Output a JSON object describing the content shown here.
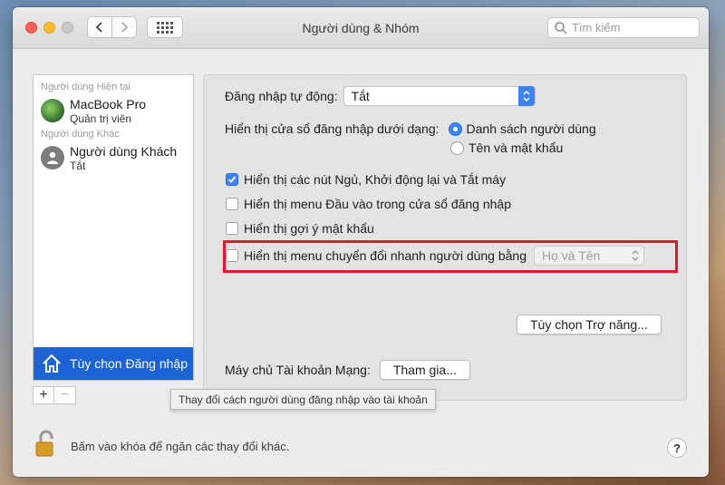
{
  "window": {
    "title": "Người dùng & Nhóm"
  },
  "toolbar": {
    "back_icon": "chevron-left-icon",
    "forward_icon": "chevron-right-icon",
    "grid_icon": "grid-icon",
    "search_placeholder": "Tìm kiếm"
  },
  "sidebar": {
    "current_header": "Người dùng Hiện tại",
    "other_header": "Người dùng Khác",
    "users": [
      {
        "name": "MacBook Pro",
        "role": "Quản trị viên"
      },
      {
        "name": "Người dùng Khách",
        "role": "Tắt"
      }
    ],
    "login_options_label": "Tùy chọn Đăng nhập",
    "add_label": "+",
    "remove_label": "−"
  },
  "tooltip": "Thay đổi cách người dùng đăng nhập vào tài khoản",
  "panel": {
    "auto_login_label": "Đăng nhập tự động:",
    "auto_login_value": "Tắt",
    "display_login_label": "Hiển thị cửa sổ đăng nhập dưới dạng:",
    "radio_list": "Danh sách người dùng",
    "radio_name_password": "Tên và mật khẩu",
    "check_sleep_restart": "Hiển thị các nút Ngủ, Khởi động lại và Tắt máy",
    "check_input_menu": "Hiển thị menu Đầu vào trong cửa sổ đăng nhập",
    "check_password_hint": "Hiển thị gợi ý mật khẩu",
    "check_fast_switch": "Hiển thị menu chuyển đổi nhanh người dùng bằng",
    "fast_switch_value": "Họ và Tên",
    "accessibility_button": "Tùy chọn Trợ năng...",
    "network_server_label": "Máy chủ Tài khoản Mạng:",
    "join_button": "Tham gia..."
  },
  "footer": {
    "lock_text": "Bấm vào khóa để ngăn các thay đổi khác.",
    "help_label": "?"
  },
  "colors": {
    "accent": "#3d83f5",
    "selection": "#1d63d6",
    "highlight": "#e4152c"
  }
}
